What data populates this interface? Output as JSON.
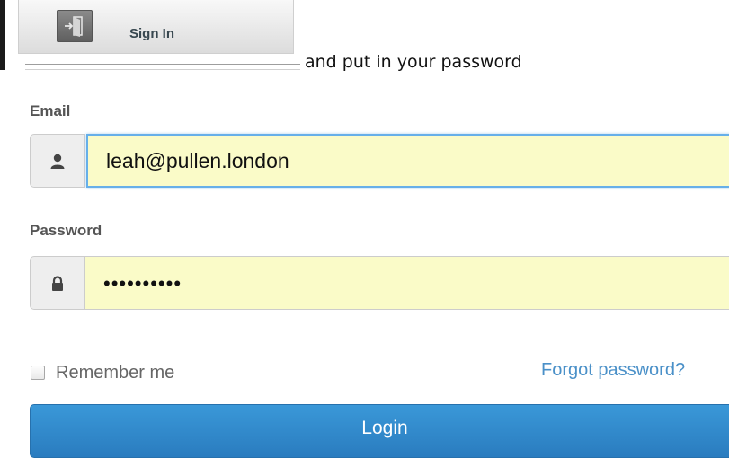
{
  "signin_snippet": {
    "label": "Sign In",
    "icon": "sign-in-icon"
  },
  "instruction": "and put in your password",
  "form": {
    "email": {
      "label": "Email",
      "value": "leah@pullen.london",
      "icon": "user-icon"
    },
    "password": {
      "label": "Password",
      "value": "••••••••••",
      "icon": "lock-icon"
    },
    "remember_label": "Remember me",
    "remember_checked": false,
    "forgot_label": "Forgot password?",
    "login_label": "Login"
  },
  "colors": {
    "autofill_bg": "#fafbc8",
    "focus_border": "#66afe9",
    "link": "#4a90c8",
    "button": "#2f88cc"
  }
}
